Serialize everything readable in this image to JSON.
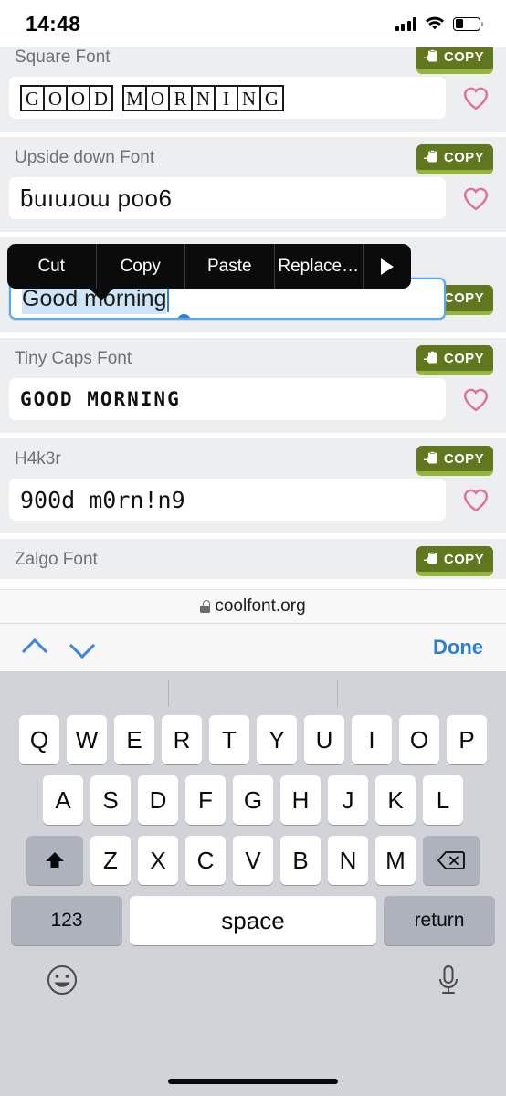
{
  "status_bar": {
    "time": "14:48",
    "signal_icon": "cellular-bars-icon",
    "wifi_icon": "wifi-icon",
    "battery_icon": "battery-icon",
    "battery_level_percent": 35
  },
  "page": {
    "url": "coolfont.org",
    "lock_icon": "lock-icon",
    "copy_label": "COPY",
    "copy_icon": "clipboard-copy-icon",
    "favorite_icon": "heart-icon",
    "accent_green_dark": "#60761f",
    "accent_green_light": "#93b63a",
    "heart_pink": "#e0719b",
    "card_bg": "#eceef0",
    "rows": [
      {
        "label": "Square Font",
        "value": "GOOD MORNING",
        "style": "square"
      },
      {
        "label": "Upside down Font",
        "value": "ƃuıuɹoɯ poo6",
        "style": "upside"
      },
      {
        "label": "",
        "value": "Good morning",
        "style": "focused"
      },
      {
        "label": "Tiny Caps Font",
        "value": "GOOD MORNING",
        "style": "tinycaps"
      },
      {
        "label": "H4k3r",
        "value": "900d m0rn!n9",
        "style": "hacker"
      },
      {
        "label": "Zalgo Font",
        "value": "",
        "style": "cutoff"
      }
    ]
  },
  "edit_menu": {
    "items": [
      "Cut",
      "Copy",
      "Paste",
      "Replace…"
    ],
    "more_icon": "triangle-right-icon"
  },
  "keyboard_accessory": {
    "prev_icon": "chevron-up-icon",
    "next_icon": "chevron-down-icon",
    "done_label": "Done"
  },
  "keyboard": {
    "row1": [
      "Q",
      "W",
      "E",
      "R",
      "T",
      "Y",
      "U",
      "I",
      "O",
      "P"
    ],
    "row2": [
      "A",
      "S",
      "D",
      "F",
      "G",
      "H",
      "J",
      "K",
      "L"
    ],
    "row3": [
      "Z",
      "X",
      "C",
      "V",
      "B",
      "N",
      "M"
    ],
    "shift_icon": "shift-up-arrow-icon",
    "backspace_icon": "backspace-delete-icon",
    "numeric_label": "123",
    "space_label": "space",
    "return_label": "return",
    "emoji_icon": "emoji-smiley-icon",
    "dictation_icon": "microphone-icon"
  }
}
